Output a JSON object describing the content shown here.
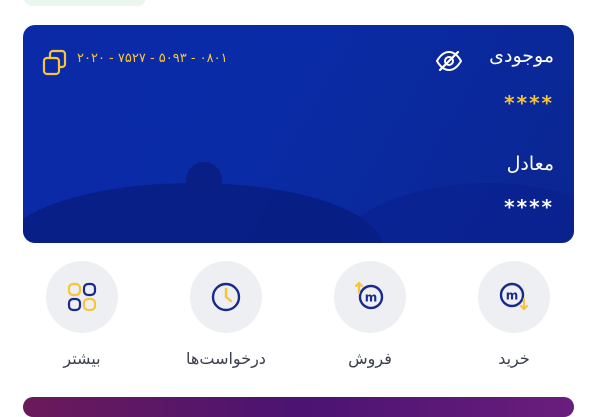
{
  "wallet_card": {
    "balance_label": "موجودی",
    "balance_value": "****",
    "equivalent_label": "معادل",
    "equivalent_value": "****",
    "card_number": "۲۰۲۰ - ۷۵۲۷ - ۵۰۹۳ - ۰۸۰۱",
    "card_color": "#0b2aa8",
    "accent_color": "#f7c53b"
  },
  "actions": [
    {
      "label": "خرید",
      "icon": "buy-icon"
    },
    {
      "label": "فروش",
      "icon": "sell-icon"
    },
    {
      "label": "درخواست‌ها",
      "icon": "clock-icon"
    },
    {
      "label": "بیشتر",
      "icon": "grid-icon"
    }
  ]
}
